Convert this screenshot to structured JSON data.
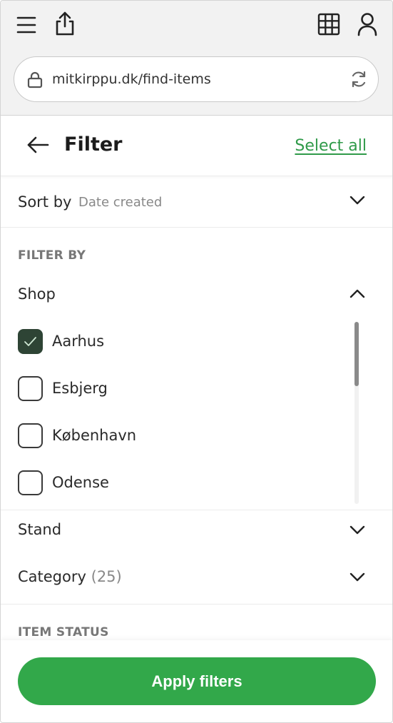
{
  "browser": {
    "url": "mitkirppu.dk/find-items"
  },
  "header": {
    "title": "Filter",
    "select_all": "Select all"
  },
  "sort": {
    "label": "Sort by",
    "value": "Date created"
  },
  "filter_by": {
    "heading": "FILTER BY",
    "shop": {
      "label": "Shop",
      "options": [
        {
          "label": "Aarhus",
          "checked": true
        },
        {
          "label": "Esbjerg",
          "checked": false
        },
        {
          "label": "København",
          "checked": false
        },
        {
          "label": "Odense",
          "checked": false
        }
      ]
    },
    "stand": {
      "label": "Stand"
    },
    "category": {
      "label": "Category",
      "count": "(25)"
    }
  },
  "item_status": {
    "heading": "ITEM STATUS"
  },
  "footer": {
    "apply": "Apply filters"
  },
  "colors": {
    "accent": "#32a84a",
    "checked": "#2e4435"
  }
}
